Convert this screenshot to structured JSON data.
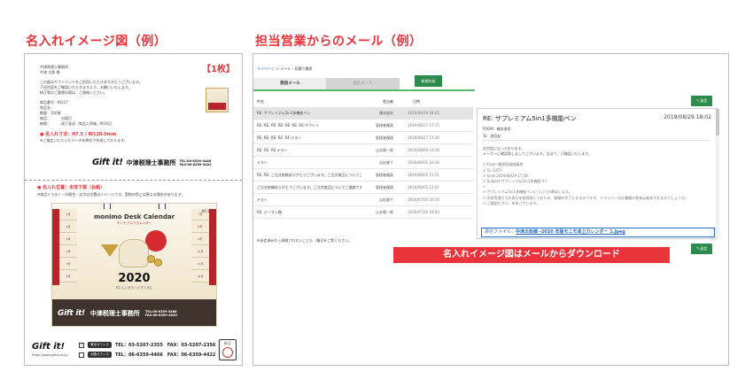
{
  "headings": {
    "left": "名入れイメージ図（例）",
    "right": "担当営業からのメール（例）"
  },
  "document": {
    "badge": "【1枚】",
    "lines": [
      "中津税理士事務所",
      "中津 太郎 様",
      "",
      "この度はギフトイットをご利用いただきありがとうございます。",
      "下記内容をご確認いただきますよう、お願いいたします。",
      "修正等のご要望の際は、ご連絡ください。",
      "",
      "商品番号：KI117",
      "商品名：",
      "数量：100冊",
      "納品：　　　出版日",
      "納期：　　　成了発送（商品入荷後、約10日"
    ],
    "size_line": "● 名入れ寸法：H7.5 / W120.0mm",
    "size_note": "※ご指定いただいたデータを弊社で作成しております。",
    "logo": "Gift it!",
    "office": "中津税理士事務所",
    "tel": "TEL:06-6359-4466",
    "fax": "FAX:06-6359-4422",
    "position_title": "● 名入れ位置：本体下部（台紙）",
    "position_note": "※商品イラスト・印刷色・文字の位置はイメージです。実物の色とは異なる場合があります。",
    "calendar": {
      "code": "KI117",
      "title": "monimo Desk Calendar",
      "subtitle": "モニモ デスクカレンダー",
      "year": "2020",
      "year_sub": "おいしいをもっとすてきに",
      "months_left": [
        "1月",
        "2月",
        "3月",
        "4月",
        "5月",
        "6月"
      ],
      "months_right": [
        "7月",
        "8月",
        "9月",
        "10月",
        "11月",
        "12月"
      ],
      "office": "中津税理士事務所",
      "tel": "TEL:06-6359-4466",
      "fax": "FAX:06-6359-4422"
    },
    "footer": {
      "logo": "Gift it!",
      "url": "https://www.giftit.co.jp/",
      "row1_check": "✓",
      "row1_pill": "東京オフィス",
      "row1_tel": "TEL：03-5207-2355　FAX：03-5207-2356",
      "row2_check": "",
      "row2_pill": "大阪オフィス",
      "row2_tel": "TEL：06-6359-4466　FAX：06-6359-4422",
      "stamp": "校正"
    }
  },
  "mail": {
    "breadcrumb_link": "マイページ",
    "breadcrumb_rest": " ＞ メール・見積り履歴",
    "tabs": {
      "received": "受信メール",
      "sent": "送信メール"
    },
    "new_button": "新規作成",
    "reply_label": "↰ 返信",
    "columns": {
      "subject": "件名",
      "sender": "差出者",
      "date": "日時"
    },
    "rows": [
      {
        "subject": "RE: ザプレミアム5in1多機能ペン",
        "sender": "橋本俊尚",
        "date": "2019/08/29 18:02"
      },
      {
        "subject": "RE: RE: RE: RE: RE: RE: RE:ギフトイ",
        "sender": "管理者権限",
        "date": "2019/08/27 17:15"
      },
      {
        "subject": "RE: RE: RE: RE: RE:テスト",
        "sender": "管理者権限",
        "date": "2019/08/27 17:30"
      },
      {
        "subject": "RE: RE: RE:テスト",
        "sender": "山本陽一郎",
        "date": "2019/08/09 14:30"
      },
      {
        "subject": "テスト",
        "sender": "吉松美千",
        "date": "2019/08/01 10:36"
      },
      {
        "subject": "RE: RE: ご注文依頼ありがとうございます。ご注文商品についてご連絡です。",
        "sender": "管理者権限",
        "date": "2019/08/01 13:51"
      },
      {
        "subject": "ご注文依頼ありがとうございます。ご注文商品についてご連絡です。",
        "sender": "管理者権限",
        "date": "2019/08/01 13:47"
      },
      {
        "subject": "テスト",
        "sender": "吉松美千",
        "date": "2019/07/26 16:16"
      },
      {
        "subject": "RE: データ入稿",
        "sender": "山本陽一郎",
        "date": "2019/07/26 19:25"
      }
    ],
    "list_note": "※送信済みから再開されないことも（最近をご覧ください。",
    "viewer": {
      "subject": "RE: ザプレミアム5in1多機能ペン",
      "date": "2019/08/29 18:02",
      "from": "FROM：橋本俊尚",
      "to": "To：池田友",
      "body": [
        "お世話になっております。",
        "メーカーに確認致しましてございます。当当て、ご確認いたします。",
        "",
        "> From: 最続続連絡漏洩",
        "> To: GIFT!",
        "> Sent:2019/08/29 17:50",
        "> Subject:ザプレミアム5in1多機能ペン",
        "> ",
        "> ザプレミアム5in1多機能ペンについてお尋ねします。",
        "> 名前等通りでの表示を取得致しておりみ、御検を完了となるのですが、ドライバーはの種類の使来は被来されるのでしょうか。",
        "> ご確認ださい，所有ございます。"
      ],
      "attach_label": "添付ファイル：",
      "attach_file": "中津太郎様 -2020 年版モニモ卓上カレンダー 1.jpeg"
    },
    "callout": "名入れイメージ図はメールからダウンロード"
  }
}
